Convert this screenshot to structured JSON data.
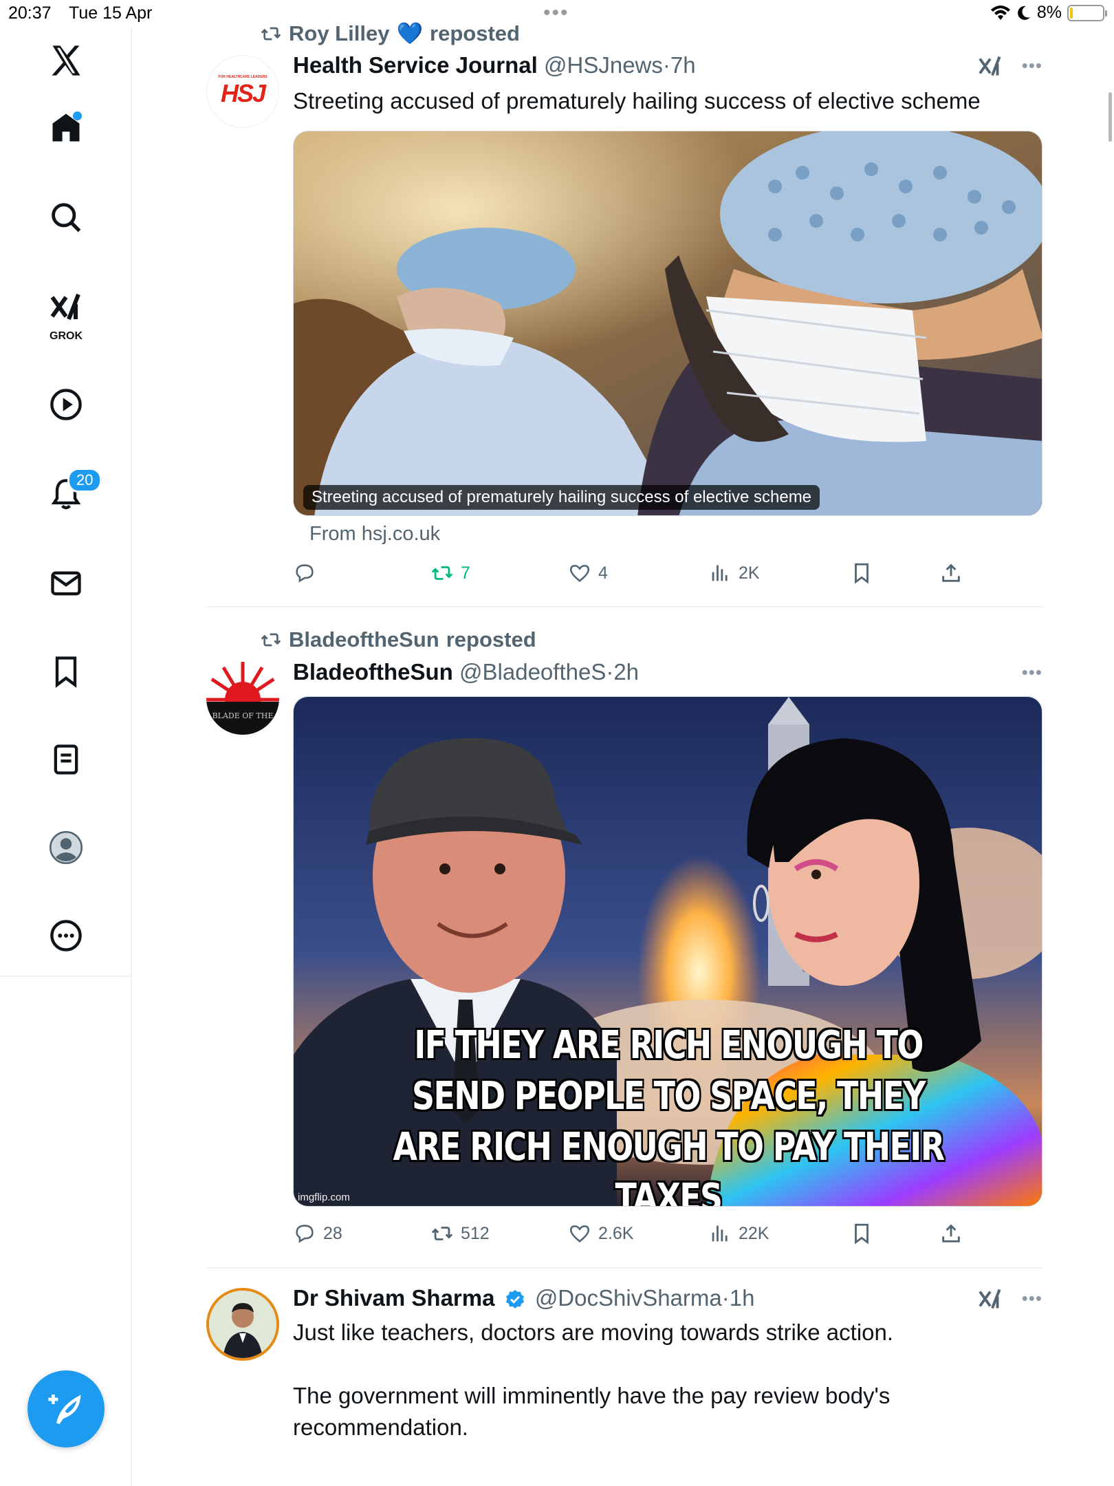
{
  "status_bar": {
    "time": "20:37",
    "date": "Tue 15 Apr",
    "battery": "8%",
    "battery_level": 0.08
  },
  "sidebar": {
    "items": [
      {
        "name": "x-logo"
      },
      {
        "name": "home",
        "has_dot": true
      },
      {
        "name": "search"
      },
      {
        "name": "grok",
        "label": "GROK"
      },
      {
        "name": "videos"
      },
      {
        "name": "notifications",
        "badge": "20"
      },
      {
        "name": "messages"
      },
      {
        "name": "bookmarks"
      },
      {
        "name": "lists"
      },
      {
        "name": "profile"
      },
      {
        "name": "more"
      }
    ]
  },
  "posts": [
    {
      "repost_by": "Roy Lilley",
      "repost_emoji": "💙",
      "repost_suffix": "reposted",
      "name": "Health Service Journal",
      "handle": "@HSJnews",
      "time": "7h",
      "text": "Streeting accused of prematurely hailing success of elective scheme",
      "avatar_text": "HSJ",
      "avatar_subtext": "FOR HEALTHCARE LEADERS",
      "card_caption": "Streeting accused of prematurely hailing success of elective scheme",
      "from": "From hsj.co.uk",
      "replies": "",
      "reposts": "7",
      "likes": "4",
      "views": "2K",
      "colors": {
        "repost_active": "#00ba7c",
        "brand_red": "#e2231a"
      }
    },
    {
      "repost_by": "BladeoftheSun",
      "repost_suffix": "reposted",
      "name": "BladeoftheSun",
      "handle": "@BladeoftheS",
      "time": "2h",
      "avatar_text": "BLADE OF THE",
      "meme_lines": [
        "IF THEY ARE RICH ENOUGH TO",
        "SEND PEOPLE TO SPACE, THEY",
        "ARE RICH ENOUGH TO PAY THEIR TAXES"
      ],
      "watermark": "imgflip.com",
      "replies": "28",
      "reposts": "512",
      "likes": "2.6K",
      "views": "22K"
    },
    {
      "name": "Dr Shivam Sharma",
      "handle": "@DocShivSharma",
      "time": "1h",
      "verified": true,
      "paragraphs": [
        "Just like teachers, doctors are moving towards strike action.",
        "The government will imminently have the pay review body's recommendation."
      ]
    }
  ],
  "colors": {
    "accent": "#1d9bf0",
    "text": "#0f1419",
    "muted": "#536471"
  }
}
